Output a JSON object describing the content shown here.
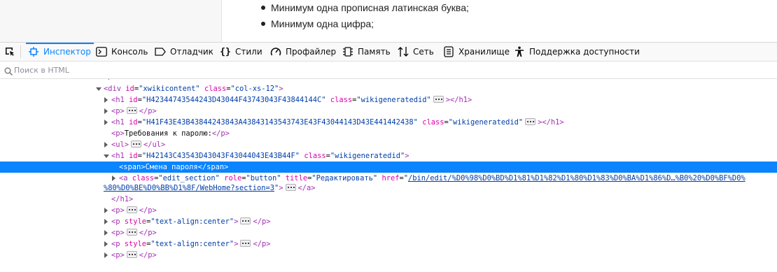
{
  "page": {
    "bullets": [
      "Минимум одна прописная латинская буква;",
      "Минимум одна цифра;"
    ]
  },
  "toolbar": {
    "tabs": [
      {
        "label": "Инспектор",
        "icon": "inspector-icon",
        "active": true
      },
      {
        "label": "Консоль",
        "icon": "console-icon"
      },
      {
        "label": "Отладчик",
        "icon": "debugger-icon"
      },
      {
        "label": "Стили",
        "icon": "braces-icon"
      },
      {
        "label": "Профайлер",
        "icon": "gauge-icon"
      },
      {
        "label": "Память",
        "icon": "memory-chip-icon"
      },
      {
        "label": "Сеть",
        "icon": "network-arrows-icon"
      },
      {
        "label": "Хранилище",
        "icon": "storage-icon"
      },
      {
        "label": "Поддержка доступности",
        "icon": "accessibility-icon"
      }
    ],
    "accent": "#0a84ff"
  },
  "search": {
    "placeholder": "Поиск в HTML",
    "value": ""
  },
  "tree": {
    "r0": {
      "open": "<div",
      "a1": "id",
      "v1": "\"xwikicontent\"",
      "a2": "class",
      "v2": "\"col-xs-12\"",
      "close": ">"
    },
    "r1": {
      "open": "<h1",
      "a1": "id",
      "v1": "\"H42344743544243D43044F43743043F43844144C\"",
      "a2": "class",
      "v2": "\"wikigeneratedid\"",
      "close": "></h1>"
    },
    "r2": {
      "open": "<p>",
      "close": "</p>"
    },
    "r3": {
      "open": "<h1",
      "a1": "id",
      "v1": "\"H41F43E43B43844243843A43843143543743E43F43044143D43E441442438\"",
      "a2": "class",
      "v2": "\"wikigeneratedid\"",
      "close": "></h1>"
    },
    "r4": {
      "open": "<p>",
      "text": "Требования к паролю:",
      "close": "</p>"
    },
    "r5": {
      "open": "<ul>",
      "close": "</ul>"
    },
    "r6": {
      "open": "<h1",
      "a1": "id",
      "v1": "\"H42143C43543D43043F43044043E43B44F\"",
      "a2": "class",
      "v2": "\"wikigeneratedid\"",
      "close": ">"
    },
    "r7": {
      "open": "<span>",
      "text": "Смена пароля",
      "close": "</span>"
    },
    "r8": {
      "open": "<a",
      "a1": "class",
      "v1": "\"edit_section\"",
      "a2": "role",
      "v2": "\"button\"",
      "a3": "title",
      "v3": "\"Редактировать\"",
      "a4": "href",
      "v4": "\"",
      "link": "/bin/edit/%D0%98%D0%BD%D1%81%D1%82%D1%80%D1%83%D0%BA%D1%86%D…%B0%20%D0%BF%D0%",
      "link2": "%80%D0%BE%D0%BB%D1%8F/WebHome?section=3",
      "v4end": "\"",
      "close": "</a>"
    },
    "r9": {
      "close": "</h1>"
    },
    "r10": {
      "open": "<p>",
      "close": "</p>"
    },
    "r11": {
      "open": "<p",
      "a1": "style",
      "v1": "\"text-align:center\"",
      "close": "</p>"
    },
    "r12": {
      "open": "<p>",
      "close": "</p>"
    },
    "r13": {
      "open": "<p",
      "a1": "style",
      "v1": "\"text-align:center\"",
      "close": "</p>"
    },
    "r14": {
      "open": "<p>",
      "close": "</p>"
    },
    "selection_color": "#0a84ff"
  }
}
